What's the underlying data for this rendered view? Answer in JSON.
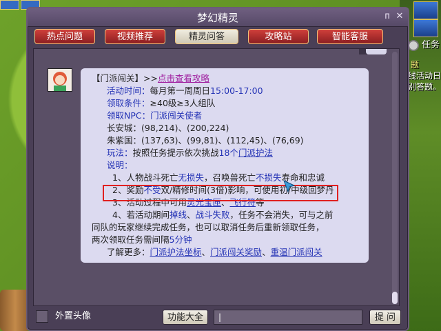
{
  "window": {
    "title": "梦幻精灵",
    "pin_glyph": "ᴨ",
    "close_glyph": "✕"
  },
  "tabs": [
    {
      "label": "热点问题"
    },
    {
      "label": "视频推荐"
    },
    {
      "label": "精灵问答"
    },
    {
      "label": "攻略站"
    },
    {
      "label": "智能客服"
    }
  ],
  "message": {
    "title_prefix": "【门派闯关】>>",
    "title_link": "点击查看攻略",
    "time_label": "活动时间：",
    "time_value": "每月第一周周日",
    "time_hours": "15:00-17:00",
    "cond_label": "领取条件：",
    "cond_value": "≥40级≥3人组队",
    "npc_label": "领取NPC：",
    "npc_value": "门派闯关使者",
    "city1": "长安城：(98,214)、(200,224)",
    "city2": "朱紫国：(137,63)、(99,81)、(112,45)、(76,69)",
    "play_label": "玩法：",
    "play_text": "按照任务提示依次挑战",
    "play_count": "18个",
    "play_link": "门派护法",
    "desc_label": "说明：",
    "desc1_a": "1、人物战斗死亡",
    "desc1_b": "无损失",
    "desc1_c": "，召唤兽死亡",
    "desc1_d": "不损失",
    "desc1_e": "寿命和忠诚",
    "desc2_a": "2、奖励",
    "desc2_b": "不受",
    "desc2_c": "双/精修时间(3倍)影响，可使用初/中级回梦丹",
    "desc3_a": "3、活动过程中可用",
    "desc3_b": "灵光宝匣",
    "desc3_c": "、",
    "desc3_d": "飞行符",
    "desc3_e": "等",
    "desc4_a": "4、若活动期间",
    "desc4_b": "掉线",
    "desc4_c": "、",
    "desc4_d": "战斗失败",
    "desc4_e": "，任务不会消失，可与之前",
    "desc4_f": "同队的玩家继续完成任务，也可以取消任务后重新领取任务，",
    "desc4_g": "两次领取任务需间隔",
    "desc4_h": "5分钟",
    "more_label": "了解更多：",
    "more_link1": "门派护法坐标",
    "more_sep1": "、",
    "more_link2": "门派闯关奖励",
    "more_sep2": "、",
    "more_link3": "重温门派闯关"
  },
  "bottom": {
    "checkbox_label": "外置头像",
    "func_button": "功能大全",
    "input_value": "|",
    "ask_button": "提 问"
  },
  "game_side": {
    "task_label": "任务",
    "text_line1": "题",
    "text_line2": "线活动日",
    "text_line3": "别答题。"
  }
}
